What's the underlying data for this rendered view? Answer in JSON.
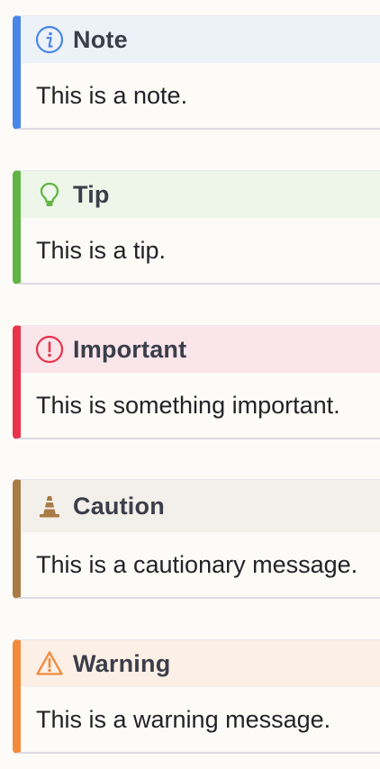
{
  "callouts": [
    {
      "title": "Note",
      "body": "This is a note.",
      "icon": "info-circle-icon",
      "accent": "#4a86e8",
      "header_bg": "#edf2f9"
    },
    {
      "title": "Tip",
      "body": "This is a tip.",
      "icon": "lightbulb-icon",
      "accent": "#62b544",
      "header_bg": "#eef6e9"
    },
    {
      "title": "Important",
      "body": "This is something important.",
      "icon": "exclamation-circle-icon",
      "accent": "#e8334a",
      "header_bg": "#f9e5ea"
    },
    {
      "title": "Caution",
      "body": "This is a cautionary message.",
      "icon": "traffic-cone-icon",
      "accent": "#a97b45",
      "header_bg": "#f3efea"
    },
    {
      "title": "Warning",
      "body": "This is a warning message.",
      "icon": "warning-triangle-icon",
      "accent": "#f28a3b",
      "header_bg": "#fcf0e6"
    }
  ]
}
